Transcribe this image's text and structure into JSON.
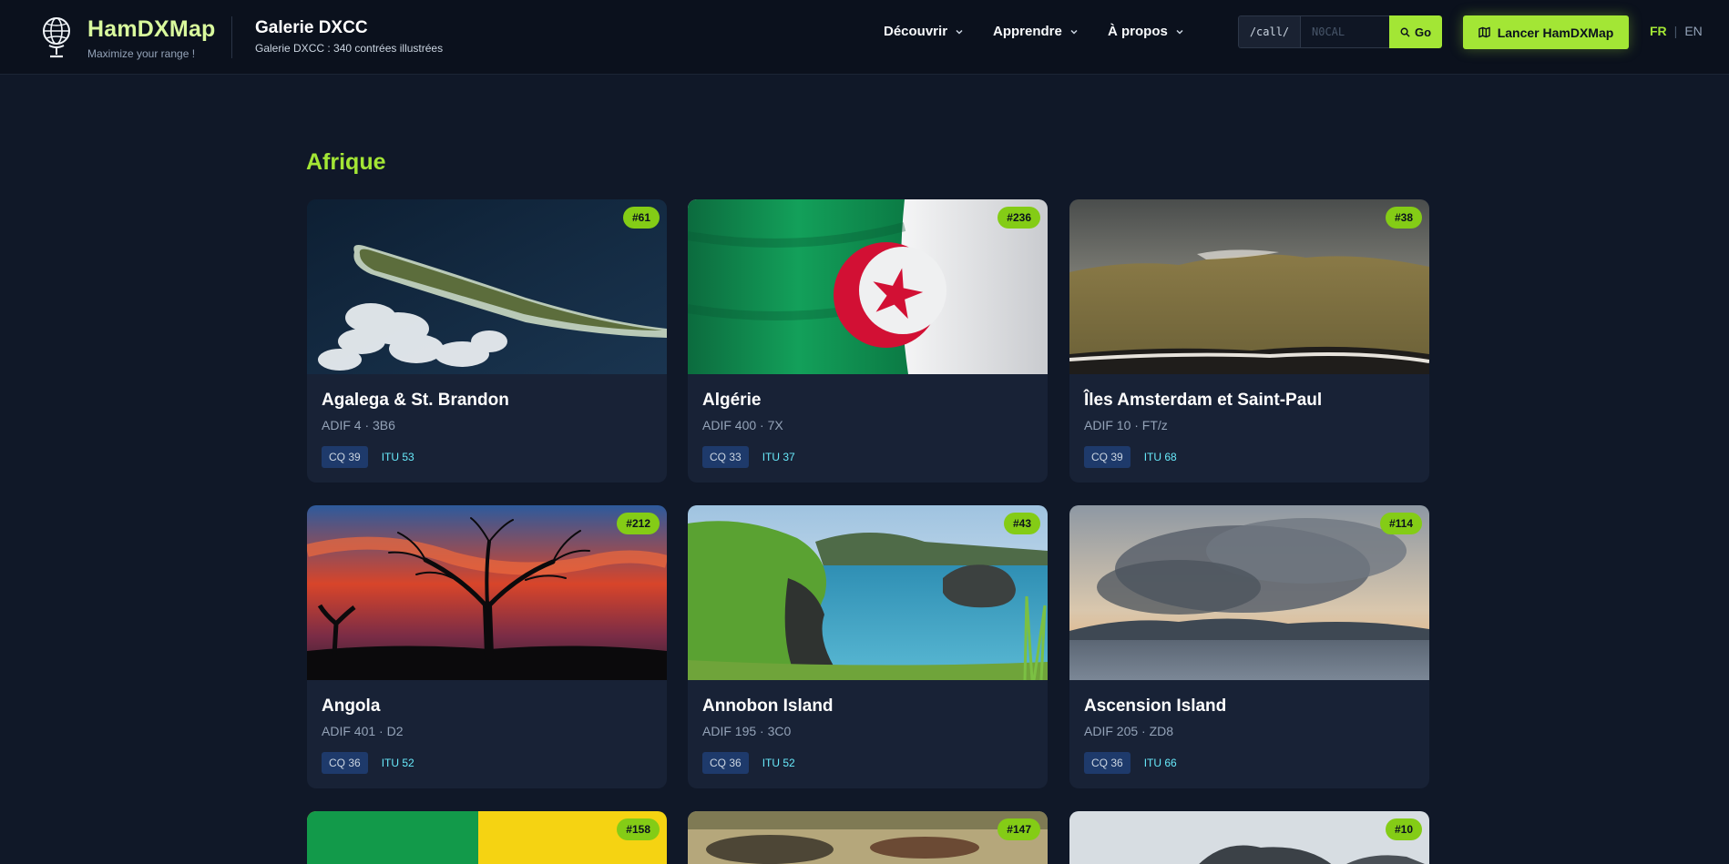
{
  "brand": {
    "name": "HamDXMap",
    "tagline": "Maximize your range !"
  },
  "header": {
    "title": "Galerie DXCC",
    "subtitle": "Galerie DXCC : 340 contrées illustrées"
  },
  "nav": [
    {
      "label": "Découvrir"
    },
    {
      "label": "Apprendre"
    },
    {
      "label": "À propos"
    }
  ],
  "search": {
    "prefix": "/call/",
    "placeholder": "N0CAL",
    "button": "Go"
  },
  "launch": {
    "label": "Lancer HamDXMap"
  },
  "lang": {
    "fr": "FR",
    "separator": "|",
    "en": "EN"
  },
  "section": {
    "title": "Afrique"
  },
  "cards": [
    {
      "badge": "#61",
      "name": "Agalega & St. Brandon",
      "meta": "ADIF 4 · 3B6",
      "cq": "CQ 39",
      "itu": "ITU 53",
      "image": "atoll"
    },
    {
      "badge": "#236",
      "name": "Algérie",
      "meta": "ADIF 400 · 7X",
      "cq": "CQ 33",
      "itu": "ITU 37",
      "image": "algeria-flag"
    },
    {
      "badge": "#38",
      "name": "Îles Amsterdam et Saint-Paul",
      "meta": "ADIF 10 · FT/z",
      "cq": "CQ 39",
      "itu": "ITU 68",
      "image": "plateau-island"
    },
    {
      "badge": "#212",
      "name": "Angola",
      "meta": "ADIF 401 · D2",
      "cq": "CQ 36",
      "itu": "ITU 52",
      "image": "baobab-sunset"
    },
    {
      "badge": "#43",
      "name": "Annobon Island",
      "meta": "ADIF 195 · 3C0",
      "cq": "CQ 36",
      "itu": "ITU 52",
      "image": "green-coast"
    },
    {
      "badge": "#114",
      "name": "Ascension Island",
      "meta": "ADIF 205 · ZD8",
      "cq": "CQ 36",
      "itu": "ITU 66",
      "image": "cloudy-sea"
    },
    {
      "badge": "#158",
      "image": "green-yellow-flag"
    },
    {
      "badge": "#147",
      "image": "savanna"
    },
    {
      "badge": "#10",
      "image": "mountain-mist"
    }
  ],
  "colors": {
    "accent": "#a3e635",
    "background": "#101828",
    "card": "#182236"
  }
}
